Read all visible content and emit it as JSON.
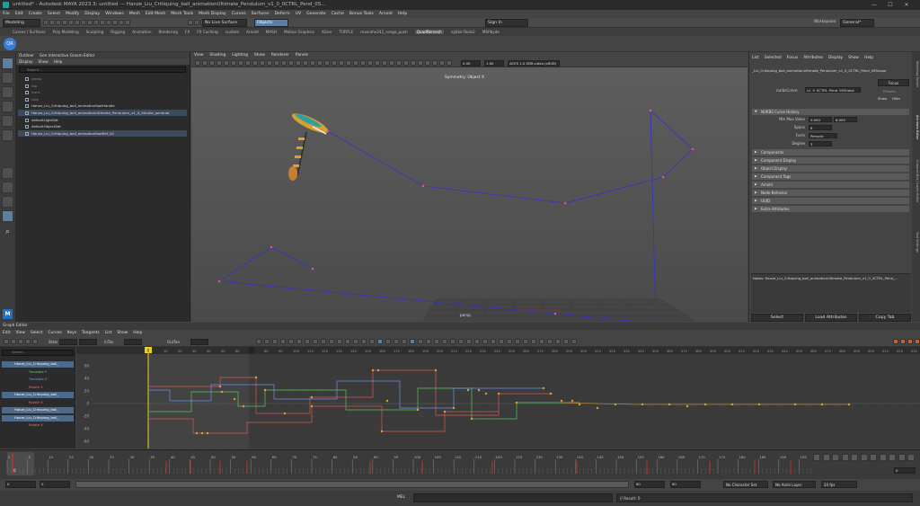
{
  "window": {
    "title": "untitled* - Autodesk MAYA 2023.3: untitled   ---   Hanze_Liu_Critiquing_ball_animationUltimate_Pendulum_v1_0_0CTRL_Pend_0S...",
    "controls": [
      "—",
      "☐",
      "✕"
    ]
  },
  "menubar": [
    "File",
    "Edit",
    "Create",
    "Select",
    "Modify",
    "Display",
    "Windows",
    "Mesh",
    "Edit Mesh",
    "Mesh Tools",
    "Mesh Display",
    "Curves",
    "Surfaces",
    "Deform",
    "UV",
    "Generate",
    "Cache",
    "Bonus Tools",
    "Arnold",
    "Help"
  ],
  "status_line": {
    "mode": "Modeling",
    "live_surface": "No Live Surface",
    "object_field": "Objects",
    "sign_in": "Sign In",
    "workspace_label": "Workspace:",
    "workspace_value": "General*"
  },
  "shelf_tabs": [
    {
      "label": "Curves / Surfaces"
    },
    {
      "label": "Poly Modeling"
    },
    {
      "label": "Sculpting"
    },
    {
      "label": "Rigging"
    },
    {
      "label": "Animation"
    },
    {
      "label": "Rendering"
    },
    {
      "label": "FX"
    },
    {
      "label": "FX Caching"
    },
    {
      "label": "custom"
    },
    {
      "label": "Arnold"
    },
    {
      "label": "MASH"
    },
    {
      "label": "Motion Graphics"
    },
    {
      "label": "XGen"
    },
    {
      "label": "TURTLE"
    },
    {
      "label": "maxiahe241_rongo_push"
    },
    {
      "label": "QuadRemesh",
      "active": true
    },
    {
      "label": "ngSkinTools2"
    },
    {
      "label": "MSPbyde"
    }
  ],
  "outliner": {
    "tabs": [
      "Outliner",
      "Gen Interactive Groom Editor"
    ],
    "menu": [
      "Display",
      "Show",
      "Help"
    ],
    "search_placeholder": "Search...",
    "items": [
      {
        "label": "persp",
        "dim": true
      },
      {
        "label": "top",
        "dim": true
      },
      {
        "label": "front",
        "dim": true
      },
      {
        "label": "side",
        "dim": true
      },
      {
        "label": "Hanze_Liu_Critiquing_ball_animationfootHandle"
      },
      {
        "label": "Hanze_Liu_Critiquing_ball_animationUltimate_Pendulum_v1_0_0Ankld_pendula",
        "selected": true
      },
      {
        "label": "defaultLightSet"
      },
      {
        "label": "defaultObjectSet"
      },
      {
        "label": "Hanze_Liu_Critiquing_ball_animationfootRef_01",
        "selected": true
      }
    ]
  },
  "viewport": {
    "menu": [
      "View",
      "Shading",
      "Lighting",
      "Show",
      "Renderer",
      "Panels"
    ],
    "field_a": "0.00",
    "field_b": "1.00",
    "color_space": "ACES 1.0 SDR-video (sRGB)",
    "symmetry": "Symmetry: Object X",
    "camera": "persp"
  },
  "attribute_editor": {
    "menu": [
      "List",
      "Selected",
      "Focus",
      "Attributes",
      "Display",
      "Show",
      "Help"
    ],
    "node_name": "_Liu_Critiquing_ball_animationUltimate_Pendulum_v1_0_0CTRL_Pend_0SShape",
    "node_label": "nurbsCurve:",
    "node_value": "v1_0_0CTRL_Pend_0SShape",
    "focus_btn": "Focus",
    "presets_btn": "Presets",
    "show_btn": "Show",
    "hide_btn": "Hide",
    "nurbs_section": "NURBS Curve History",
    "min_max_label": "Min Max Value",
    "min_value": "0.000",
    "max_value": "6.000",
    "spans_label": "Spans",
    "spans_value": "6",
    "form_label": "Form",
    "form_value": "Periodic",
    "degree_label": "Degree",
    "degree_value": "3",
    "sections": [
      "Components",
      "Component Display",
      "Object Display",
      "Component Tags",
      "Arnold",
      "Node Behavior",
      "UUID",
      "Extra Attributes"
    ],
    "notes": "Notes:  Hanze_Liu_Critiquing_ball_animationUltimate_Pendulum_v1_0_0CTRL_Pend_...",
    "buttons": [
      "Select",
      "Load Attributes",
      "Copy Tab"
    ]
  },
  "side_tabs": [
    "Modeling Toolkit",
    "Attribute Editor",
    "Channel Box / Layer Editor",
    "Tool Settings"
  ],
  "graph_editor": {
    "title": "Graph Editor",
    "menu": [
      "Edit",
      "View",
      "Select",
      "Curves",
      "Keys",
      "Tangents",
      "List",
      "Show",
      "Help"
    ],
    "stats_label": "Stats",
    "in_tan": "InTan",
    "out_tan": "OutTan",
    "search_placeholder": "Search...",
    "outliner_items": [
      {
        "label": "Hanze_Liu_Critiquing_ball_",
        "type": "obj"
      },
      {
        "label": "Translate Y",
        "color": "#6fd86f"
      },
      {
        "label": "Translate Z",
        "color": "#6f9fe8"
      },
      {
        "label": "Rotate X",
        "color": "#e86f6f"
      },
      {
        "label": "Hanze_Liu_Critiquing_ball_",
        "type": "obj"
      },
      {
        "label": "Rotate X",
        "color": "#e86f6f"
      },
      {
        "label": "Hanze_Liu_Critiquing_ball_",
        "type": "obj"
      },
      {
        "label": "Hanze_Liu_Critiquing_ball_",
        "type": "obj"
      },
      {
        "label": "Rotate X",
        "color": "#e86f6f"
      }
    ],
    "y_ticks": [
      "60",
      "40",
      "20",
      "0",
      "-20",
      "-40",
      "-60"
    ],
    "x_ticks": [
      "0",
      "10",
      "20",
      "30",
      "40",
      "50",
      "60",
      "70",
      "80",
      "90",
      "100",
      "110",
      "120",
      "130",
      "140",
      "150",
      "160",
      "170",
      "180",
      "190",
      "200",
      "210",
      "220",
      "230",
      "240",
      "250",
      "260",
      "270",
      "280",
      "290",
      "300",
      "310",
      "320",
      "330",
      "340",
      "350",
      "360",
      "370",
      "380",
      "390",
      "400",
      "410",
      "420",
      "430",
      "440",
      "450",
      "460",
      "470",
      "480",
      "490",
      "500",
      "510",
      "520",
      "530",
      "540",
      "550",
      "560",
      "570",
      "580"
    ],
    "current_frame_label": "0"
  },
  "time_slider": {
    "ticks": [
      "0",
      "5",
      "10",
      "15",
      "20",
      "25",
      "30",
      "35",
      "40",
      "45",
      "50",
      "55",
      "60",
      "65",
      "70",
      "75",
      "80",
      "85",
      "90",
      "95",
      "100",
      "105",
      "110",
      "115",
      "120",
      "125",
      "130",
      "135",
      "140",
      "145",
      "150",
      "155",
      "160",
      "165",
      "170",
      "175",
      "180",
      "185",
      "190",
      "195",
      "200"
    ],
    "current": "0",
    "right_field": "0"
  },
  "range_slider": {
    "start": "0",
    "start2": "0",
    "end": "60",
    "end2": "60",
    "character_set": "No Character Set",
    "anim_layer": "No Anim Layer",
    "fps": "24 fps"
  },
  "command_line": {
    "language": "MEL",
    "result": "// Result: 0"
  },
  "colors": {
    "curve_green": "#58c858",
    "curve_blue": "#6f8fe8",
    "curve_red": "#d85858",
    "key_orange": "#e0a030",
    "ui_accent": "#5d7fa3"
  }
}
